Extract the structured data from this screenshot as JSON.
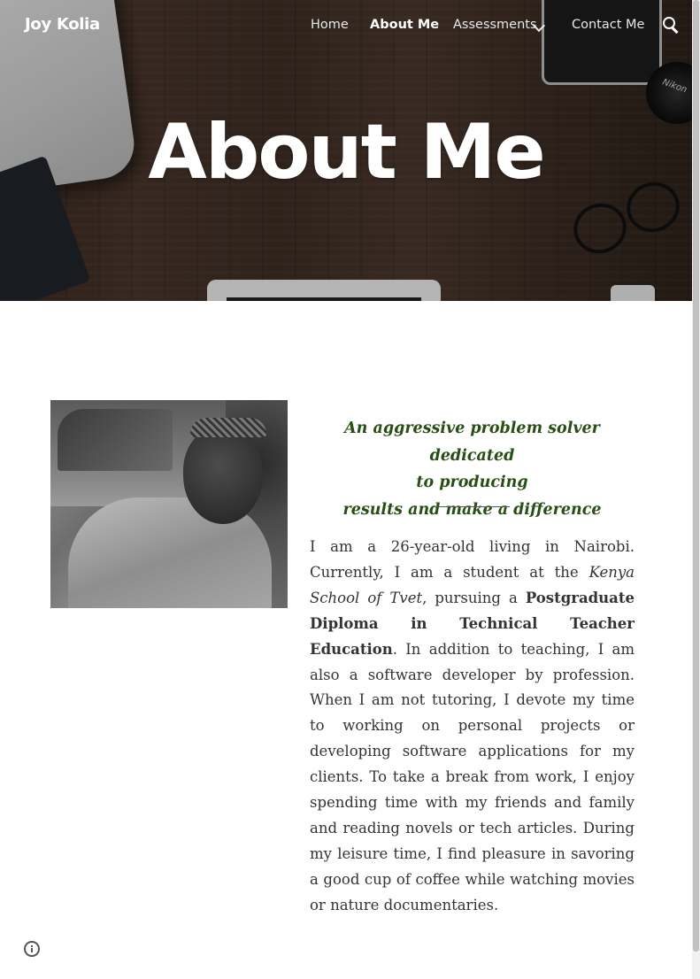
{
  "site": {
    "title": "Joy Kolia"
  },
  "nav": {
    "items": [
      {
        "label": "Home",
        "active": false
      },
      {
        "label": "About Me",
        "active": true
      },
      {
        "label": "Assessments",
        "active": false,
        "has_dropdown": true
      },
      {
        "label": "Contact Me",
        "active": false
      }
    ],
    "search_icon": "search-icon"
  },
  "hero": {
    "title": "About Me",
    "camera_brand": "Nikon"
  },
  "content": {
    "photo_alt_icon": "profile-photo",
    "tagline": {
      "line1": "An aggressive problem solver dedicated",
      "line2": "to producing",
      "line3": "results and make a difference"
    },
    "bio": {
      "part1": "I am a 26-year-old living in Nairobi. Currently, I am a student at the ",
      "school": "Kenya School of Tvet",
      "part2": ", pursuing a ",
      "program": "Postgraduate Diploma in Technical Teacher Education",
      "part3": ". In addition to teaching, I am also a software developer by profession. When I am not tutoring, I devote my time to working on personal projects or developing software applications for my clients. To take a break from work, I enjoy spending time with my friends and family and reading novels or tech articles. During my leisure time, I find pleasure in savoring a good cup of coffee while watching movies or nature documentaries."
    }
  },
  "footer": {
    "info_icon": "info-icon"
  },
  "colors": {
    "tagline": "#274e13",
    "body_text": "#333333",
    "hero_text": "#ffffff"
  }
}
